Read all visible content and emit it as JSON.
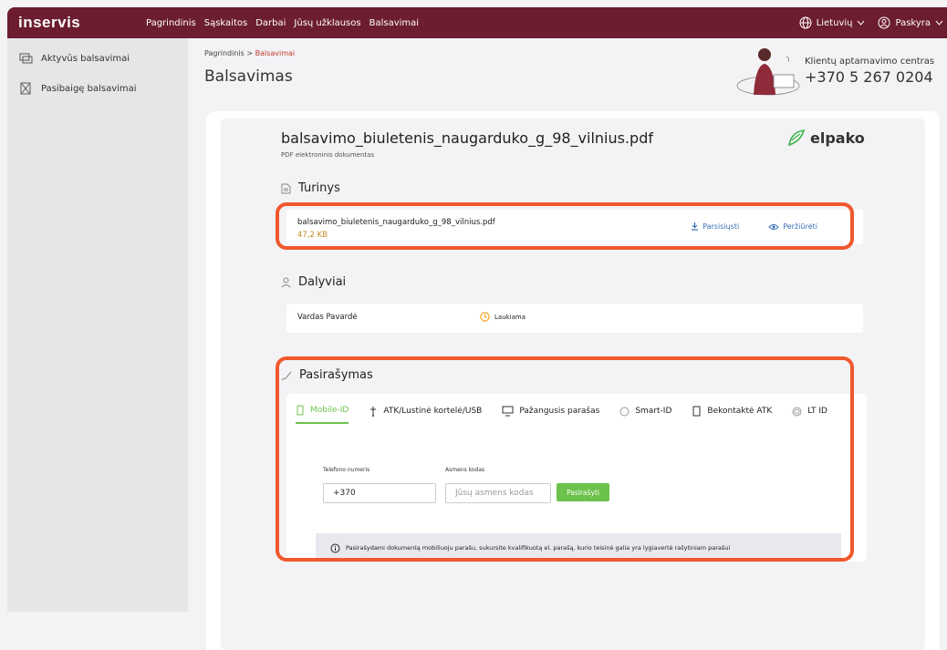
{
  "brand": {
    "logo": "inservis"
  },
  "topnav": {
    "items": [
      "Pagrindinis",
      "Sąskaitos",
      "Darbai",
      "Jūsų užklausos",
      "Balsavimai"
    ]
  },
  "topright": {
    "language": "Lietuvių",
    "account": "Paskyra"
  },
  "sidebar": {
    "items": [
      {
        "label": "Aktyvūs balsavimai",
        "icon": "ballot-icon"
      },
      {
        "label": "Pasibaigę balsavimai",
        "icon": "ballot-box-icon"
      }
    ]
  },
  "breadcrumb": {
    "home": "Pagrindinis",
    "current": "Balsavimai",
    "separator": " > "
  },
  "page": {
    "title": "Balsavimas"
  },
  "support": {
    "label": "Klientų aptarnavimo centras",
    "phone": "+370 5 267 0204"
  },
  "document": {
    "title": "balsavimo_biuletenis_naugarduko_g_98_vilnius.pdf",
    "subtitle": "PDF elektroninis dokumentas",
    "provider": "elpako"
  },
  "contents": {
    "heading": "Turinys",
    "file_name": "balsavimo_biuletenis_naugarduko_g_98_vilnius.pdf",
    "file_size": "47,2 KB",
    "download_label": "Parsisiųsti",
    "view_label": "Peržiūrėti"
  },
  "participants": {
    "heading": "Dalyviai",
    "rows": [
      {
        "name": "Vardas Pavardė",
        "status": "Laukiama"
      }
    ]
  },
  "signing": {
    "heading": "Pasirašymas",
    "tabs": [
      "Mobile-ID",
      "ATK/Lustinė kortelė/USB",
      "Pažangusis parašas",
      "Smart-ID",
      "Bekontaktė ATK",
      "LT ID"
    ],
    "active_tab": "Mobile-ID",
    "phone_label": "Telefono numeris",
    "phone_value": "+370",
    "personal_code_label": "Asmens kodas",
    "personal_code_placeholder": "Jūsų asmens kodas",
    "sign_button": "Pasirašyti",
    "info": "Pasirašydami dokumentą mobiliuoju parašu, sukursite kvalifikuotą el. parašą, kurio teisinė galia yra lygiavertė rašytiniam parašui"
  },
  "colors": {
    "topbar": "#6c1d2f",
    "accent_green": "#6cc24a",
    "highlight": "#f0582e",
    "link_blue": "#3b6fb6",
    "status_orange": "#f0a020"
  }
}
